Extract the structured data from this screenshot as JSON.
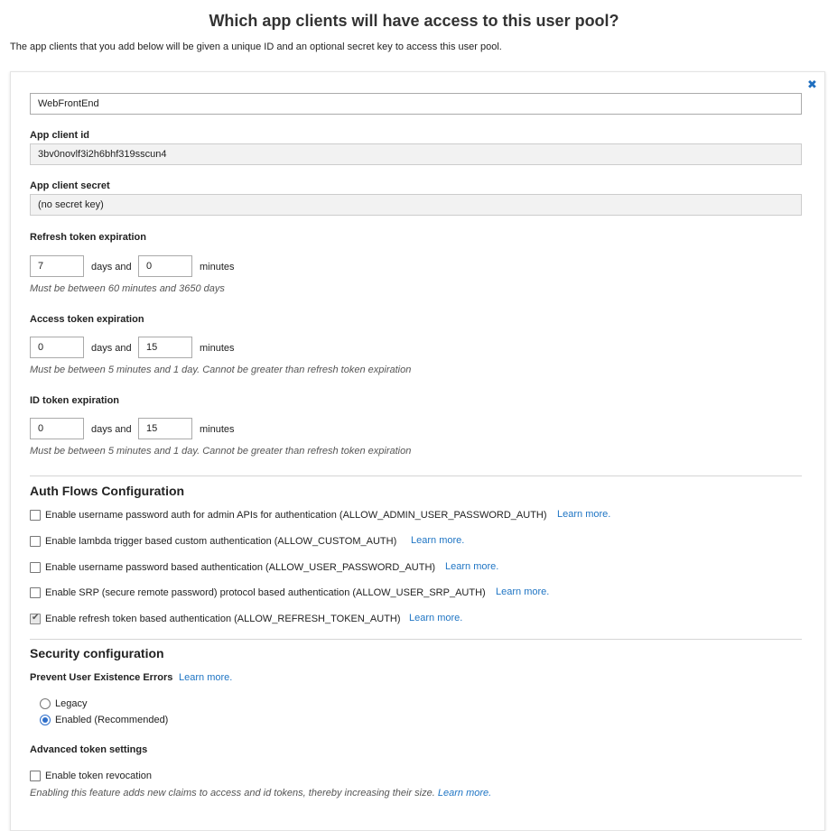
{
  "page": {
    "title": "Which app clients will have access to this user pool?",
    "subtitle": "The app clients that you add below will be given a unique ID and an optional secret key to access this user pool."
  },
  "client": {
    "name_value": "WebFrontEnd",
    "id_label": "App client id",
    "id_value": "3bv0novlf3i2h6bhf319sscun4",
    "secret_label": "App client secret",
    "secret_value": "(no secret key)"
  },
  "close_icon": "close-icon",
  "refresh_token": {
    "label": "Refresh token expiration",
    "days": "7",
    "minutes": "0",
    "days_text": "days and",
    "minutes_text": "minutes",
    "hint": "Must be between 60 minutes and 3650 days"
  },
  "access_token": {
    "label": "Access token expiration",
    "days": "0",
    "minutes": "15",
    "days_text": "days and",
    "minutes_text": "minutes",
    "hint": "Must be between 5 minutes and 1 day. Cannot be greater than refresh token expiration"
  },
  "id_token": {
    "label": "ID token expiration",
    "days": "0",
    "minutes": "15",
    "days_text": "days and",
    "minutes_text": "minutes",
    "hint": "Must be between 5 minutes and 1 day. Cannot be greater than refresh token expiration"
  },
  "auth_flows": {
    "title": "Auth Flows Configuration",
    "learn_more": "Learn more.",
    "items": [
      {
        "label": "Enable username password auth for admin APIs for authentication (ALLOW_ADMIN_USER_PASSWORD_AUTH)",
        "checked": false
      },
      {
        "label": "Enable lambda trigger based custom authentication (ALLOW_CUSTOM_AUTH)",
        "checked": false
      },
      {
        "label": "Enable username password based authentication (ALLOW_USER_PASSWORD_AUTH)",
        "checked": false
      },
      {
        "label": "Enable SRP (secure remote password) protocol based authentication (ALLOW_USER_SRP_AUTH)",
        "checked": false
      },
      {
        "label": "Enable refresh token based authentication (ALLOW_REFRESH_TOKEN_AUTH)",
        "checked": true
      }
    ]
  },
  "security": {
    "title": "Security configuration",
    "prevent_label": "Prevent User Existence Errors",
    "learn_more": "Learn more.",
    "options": [
      {
        "label": "Legacy",
        "selected": false
      },
      {
        "label": "Enabled (Recommended)",
        "selected": true
      }
    ]
  },
  "advanced": {
    "title": "Advanced token settings",
    "revocation_label": "Enable token revocation",
    "revocation_checked": false,
    "hint": "Enabling this feature adds new claims to access and id tokens, thereby increasing their size.",
    "learn_more": "Learn more."
  },
  "colors": {
    "link": "#1f75c4",
    "radio_accent": "#2f6fca",
    "readonly_bg": "#f2f2f2"
  }
}
